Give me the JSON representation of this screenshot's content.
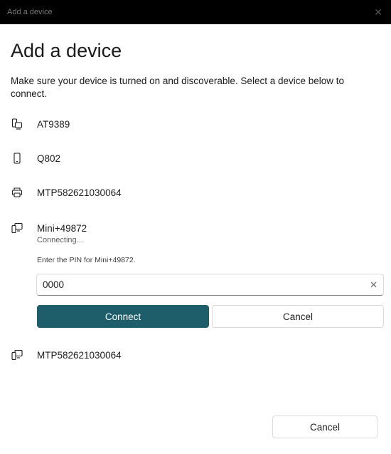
{
  "window": {
    "title": "Add a device",
    "close_glyph": "✕"
  },
  "heading": "Add a device",
  "subtitle": "Make sure your device is turned on and discoverable. Select a device below to connect.",
  "devices": [
    {
      "name": "AT9389",
      "icon": "multi-device-icon"
    },
    {
      "name": "Q802",
      "icon": "phone-icon"
    },
    {
      "name": "MTP582621030064",
      "icon": "printer-icon"
    },
    {
      "name": "Mini+49872",
      "icon": "display-device-icon",
      "status": "Connecting..."
    },
    {
      "name": "MTP582621030064",
      "icon": "display-device-icon"
    }
  ],
  "pin": {
    "prompt": "Enter the PIN for Mini+49872.",
    "value": "0000",
    "clear_glyph": "✕"
  },
  "buttons": {
    "connect": "Connect",
    "cancel_inline": "Cancel",
    "cancel_footer": "Cancel"
  },
  "colors": {
    "accent": "#1e5e6b",
    "titlebar": "#000000"
  }
}
